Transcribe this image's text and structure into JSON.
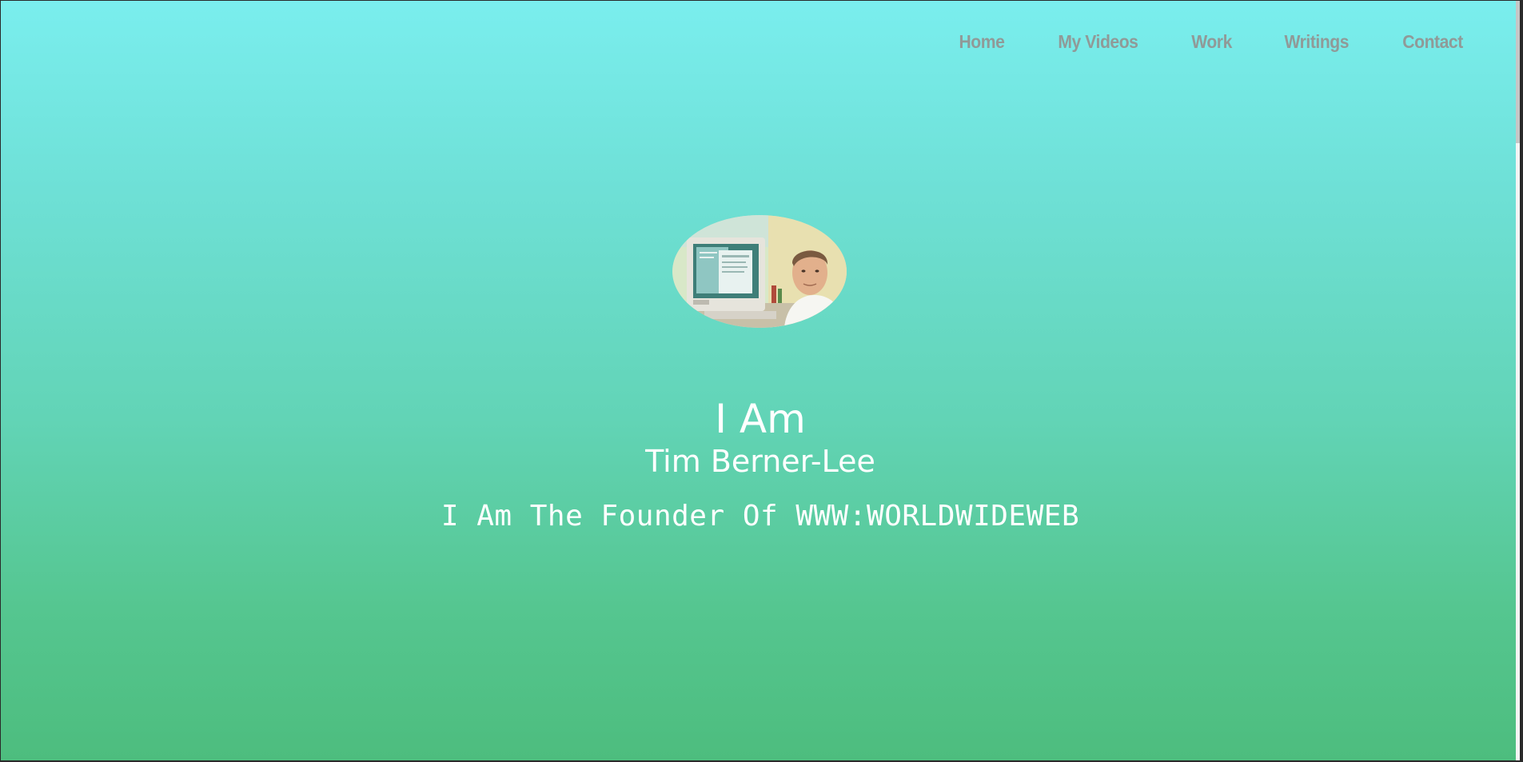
{
  "nav": {
    "items": [
      {
        "label": "Home"
      },
      {
        "label": "My Videos"
      },
      {
        "label": "Work"
      },
      {
        "label": "Writings"
      },
      {
        "label": "Contact"
      }
    ]
  },
  "hero": {
    "line1": "I Am",
    "name": "Tim Berner-Lee",
    "tagline": "I Am The Founder Of WWW:WORLDWIDEWEB"
  },
  "colors": {
    "gradient_top": "#7aeeee",
    "gradient_bottom": "#4dbd7e",
    "nav_text": "#909a98",
    "hero_text": "#ffffff"
  }
}
